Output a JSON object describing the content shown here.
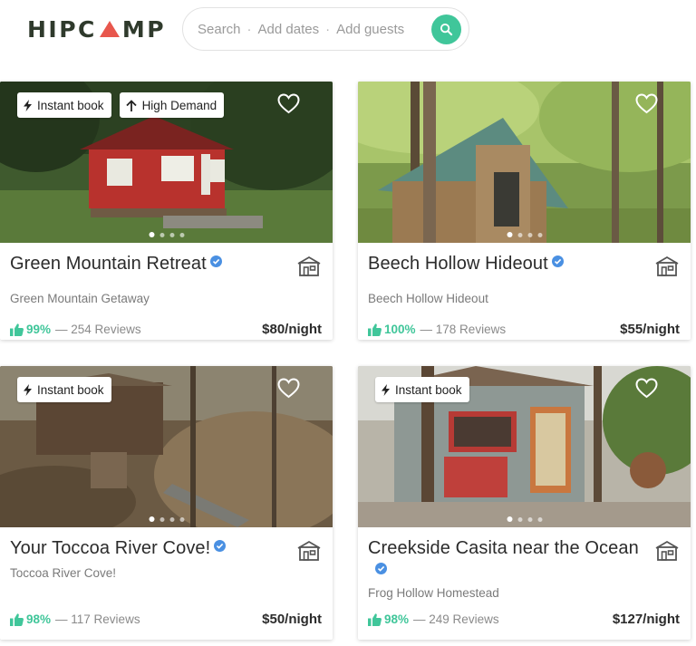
{
  "header": {
    "logo_left": "HIPC",
    "logo_right": "MP",
    "search_parts": [
      "Search",
      "Add dates",
      "Add guests"
    ]
  },
  "colors": {
    "accent": "#40c69a",
    "brand_red": "#e8574d",
    "verified": "#4a90e2"
  },
  "listings": [
    {
      "badges": [
        "Instant book",
        "High Demand"
      ],
      "title": "Green Mountain Retreat",
      "subtitle": "Green Mountain Getaway",
      "rating": "99%",
      "reviews": "— 254 Reviews",
      "price": "$80/night"
    },
    {
      "badges": [],
      "title": "Beech Hollow Hideout",
      "subtitle": "Beech Hollow Hideout",
      "rating": "100%",
      "reviews": "— 178 Reviews",
      "price": "$55/night"
    },
    {
      "badges": [
        "Instant book"
      ],
      "title": "Your Toccoa River Cove!",
      "subtitle": "Toccoa River Cove!",
      "rating": "98%",
      "reviews": "— 117 Reviews",
      "price": "$50/night"
    },
    {
      "badges": [
        "Instant book"
      ],
      "title": "Creekside Casita near the Ocean",
      "subtitle": "Frog Hollow Homestead",
      "rating": "98%",
      "reviews": "— 249 Reviews",
      "price": "$127/night"
    }
  ]
}
